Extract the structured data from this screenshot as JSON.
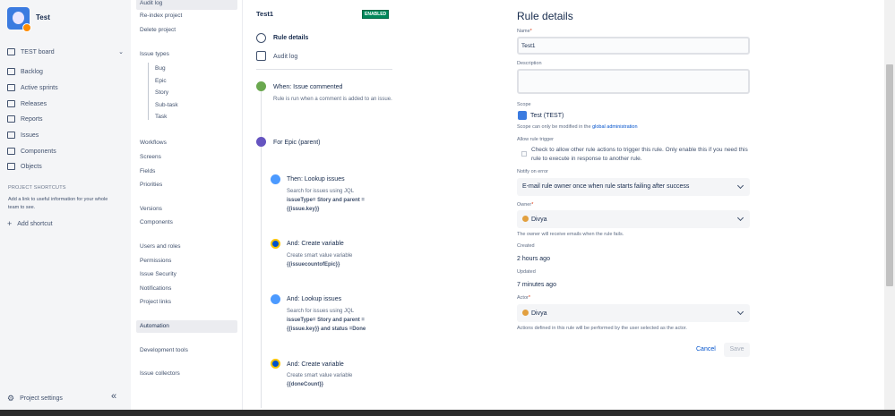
{
  "project": {
    "name": "Test"
  },
  "sidebar": {
    "board": "TEST board",
    "items": [
      {
        "label": "Backlog",
        "icon": "backlog-icon"
      },
      {
        "label": "Active sprints",
        "icon": "sprint-icon"
      },
      {
        "label": "Releases",
        "icon": "ship-icon"
      },
      {
        "label": "Reports",
        "icon": "chart-icon"
      },
      {
        "label": "Issues",
        "icon": "issues-icon"
      },
      {
        "label": "Components",
        "icon": "puzzle-icon"
      },
      {
        "label": "Objects",
        "icon": "tree-icon"
      }
    ],
    "shortcuts_header": "PROJECT SHORTCUTS",
    "shortcuts_text": "Add a link to useful information for your whole team to see.",
    "add_shortcut": "Add shortcut",
    "settings": "Project settings",
    "collapse": "«"
  },
  "settings_menu": {
    "audit_log": "Audit log",
    "reindex": "Re-index project",
    "delete": "Delete project",
    "issue_types": "Issue types",
    "types": [
      "Bug",
      "Epic",
      "Story",
      "Sub-task",
      "Task"
    ],
    "workflows": "Workflows",
    "screens": "Screens",
    "fields": "Fields",
    "priorities": "Priorities",
    "versions": "Versions",
    "components": "Components",
    "users_roles": "Users and roles",
    "permissions": "Permissions",
    "issue_security": "Issue Security",
    "notifications": "Notifications",
    "project_links": "Project links",
    "automation": "Automation",
    "dev_tools": "Development tools",
    "issue_collectors": "Issue collectors"
  },
  "rule": {
    "name": "Test1",
    "status": "ENABLED",
    "tab_details": "Rule details",
    "tab_audit": "Audit log",
    "trigger_title": "When: Issue commented",
    "trigger_desc": "Rule is run when a comment is added to an issue.",
    "branch": "For Epic (parent)",
    "steps": [
      {
        "title": "Then: Lookup issues",
        "desc": "Search for issues using JQL",
        "code": "issueType= Story and parent = {{issue.key}}"
      },
      {
        "title": "And: Create variable",
        "desc": "Create smart value variable",
        "code": "{{issuecountofEpic}}"
      },
      {
        "title": "And: Lookup issues",
        "desc": "Search for issues using JQL",
        "code": "issueType= Story and parent = {{issue.key}} and status =Done"
      },
      {
        "title": "And: Create variable",
        "desc": "Create smart value variable",
        "code": "{{doneCount}}"
      }
    ]
  },
  "details": {
    "heading": "Rule details",
    "name_label": "Name",
    "name_value": "Test1",
    "desc_label": "Description",
    "scope_label": "Scope",
    "scope_value": "Test (TEST)",
    "scope_note_pre": "Scope can only be modified in the ",
    "scope_note_link": "global administration",
    "allow_label": "Allow rule trigger",
    "allow_text": "Check to allow other rule actions to trigger this rule. Only enable this if you need this rule to execute in response to another rule.",
    "notify_label": "Notify on error",
    "notify_value": "E-mail rule owner once when rule starts failing after success",
    "owner_label": "Owner",
    "owner_value": "Divya",
    "owner_note": "The owner will receive emails when the rule fails.",
    "created_label": "Created",
    "created_value": "2 hours ago",
    "updated_label": "Updated",
    "updated_value": "7 minutes ago",
    "actor_label": "Actor",
    "actor_value": "Divya",
    "actor_note": "Actions defined in this rule will be performed by the user selected as the actor.",
    "cancel": "Cancel",
    "save": "Save"
  },
  "colors": {
    "link": "#0052cc",
    "enabled": "#00875a",
    "green_icon": "#6aa84f",
    "purple_icon": "#6554c0",
    "blue_icon": "#4c9aff"
  }
}
